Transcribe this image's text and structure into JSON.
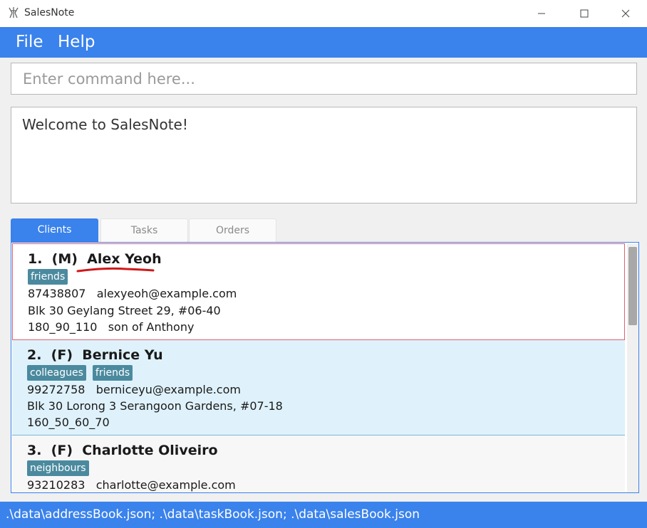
{
  "window": {
    "title": "SalesNote"
  },
  "menu": {
    "items": [
      "File",
      "Help"
    ]
  },
  "command": {
    "placeholder": "Enter command here...",
    "value": ""
  },
  "result": {
    "text": "Welcome to SalesNote!"
  },
  "tabs": [
    {
      "label": "Clients",
      "active": true
    },
    {
      "label": "Tasks",
      "active": false
    },
    {
      "label": "Orders",
      "active": false
    }
  ],
  "clients": [
    {
      "header": "1.  (M)  Alex Yeoh",
      "tags": [
        "friends"
      ],
      "contact": "87438807   alexyeoh@example.com",
      "address": "Blk 30 Geylang Street 29, #06-40",
      "extra": "180_90_110   son of Anthony"
    },
    {
      "header": "2.  (F)  Bernice Yu",
      "tags": [
        "colleagues",
        "friends"
      ],
      "contact": "99272758   berniceyu@example.com",
      "address": "Blk 30 Lorong 3 Serangoon Gardens, #07-18",
      "extra": "160_50_60_70"
    },
    {
      "header": "3.  (F)  Charlotte Oliveiro",
      "tags": [
        "neighbours"
      ],
      "contact": "93210283   charlotte@example.com",
      "address": "",
      "extra": ""
    }
  ],
  "status": {
    "text": ".\\data\\addressBook.json; .\\data\\taskBook.json; .\\data\\salesBook.json"
  },
  "colors": {
    "accent": "#3a82ec",
    "tag": "#4b8a9e",
    "selected_border": "#e06070",
    "row_alt": "#dff2fb"
  }
}
